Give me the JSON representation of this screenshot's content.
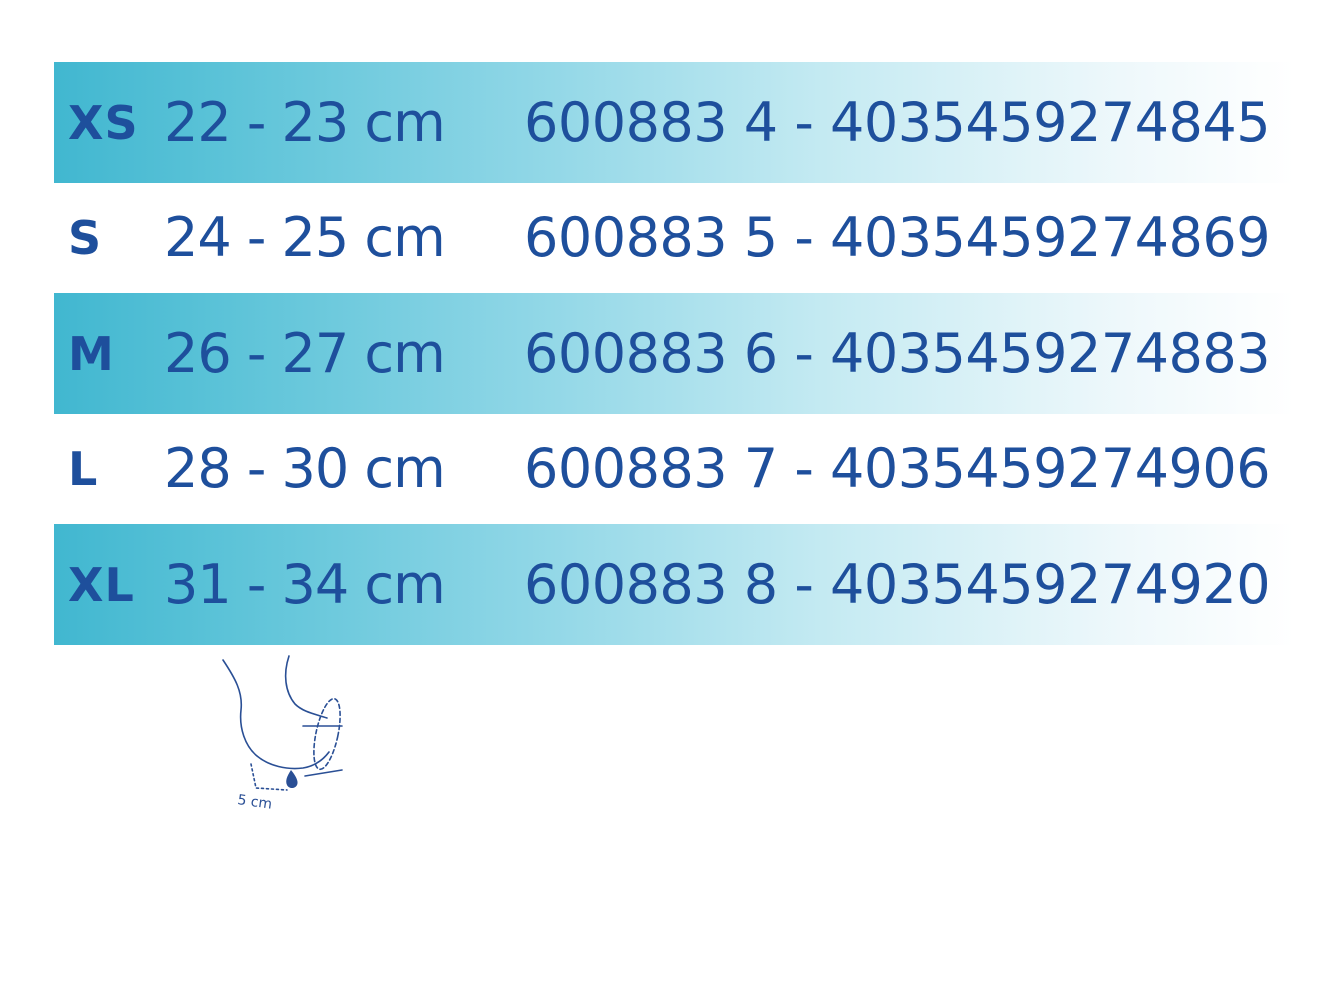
{
  "size_table": {
    "rows": [
      {
        "size": "XS",
        "range": "22 - 23 cm",
        "code": "600883 4 - 4035459274845"
      },
      {
        "size": "S",
        "range": "24 - 25 cm",
        "code": "600883 5 - 4035459274869"
      },
      {
        "size": "M",
        "range": "26 - 27 cm",
        "code": "600883 6 - 4035459274883"
      },
      {
        "size": "L",
        "range": "28 - 30 cm",
        "code": "600883 7 - 4035459274906"
      },
      {
        "size": "XL",
        "range": "31 - 34 cm",
        "code": "600883 8 - 4035459274920"
      }
    ]
  },
  "illustration": {
    "measurement_label": "5 cm",
    "icon": "elbow-measurement-icon"
  },
  "colors": {
    "text": "#1e4f9c",
    "row_shade_start": "#41b7d0",
    "row_shade_end": "#ffffff",
    "illustration_line": "#2a4f95"
  }
}
